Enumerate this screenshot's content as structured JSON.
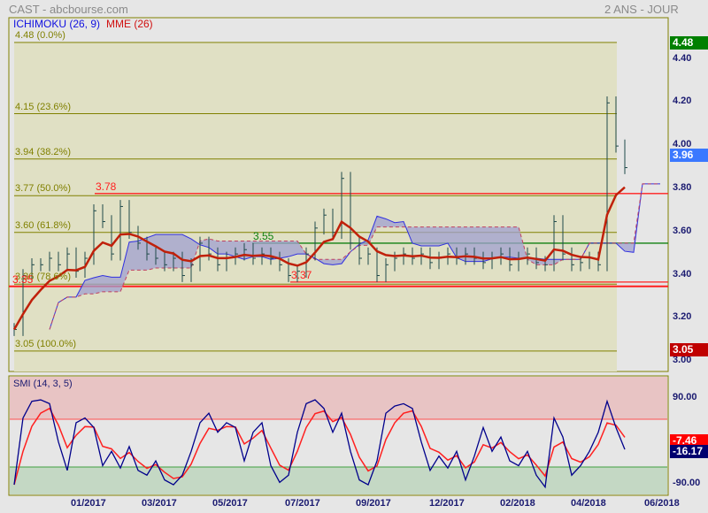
{
  "header": {
    "title": "CAST - abcbourse.com",
    "period": "2 ANS - JOUR"
  },
  "legend": {
    "ichimoku": "ICHIMOKU (26, 9)",
    "mme": "MME (26)",
    "smi": "SMI (14, 3, 5)"
  },
  "colors": {
    "price": "#1f4a4a",
    "mme": "#c0200a",
    "cloud_line": "#3030e0",
    "cloud_fill": "#a0a0d0",
    "kijun_dash": "#c04060",
    "fib": "#808000",
    "red": "#ff2020",
    "green": "#108010"
  },
  "chart_data": [
    {
      "type": "bar",
      "title": "CAST",
      "ylim": [
        3.0,
        4.48
      ],
      "y_ticks": [
        "4.40",
        "4.20",
        "4.00",
        "3.80",
        "3.60",
        "3.40",
        "3.20",
        "3.00"
      ],
      "x_ticks": [
        "01/2017",
        "03/2017",
        "05/2017",
        "07/2017",
        "09/2017",
        "12/2017",
        "02/2018",
        "04/2018",
        "06/2018"
      ],
      "fib_levels": [
        {
          "price": 4.48,
          "label": "4.48  (0.0%)"
        },
        {
          "price": 4.15,
          "label": "4.15  (23.6%)"
        },
        {
          "price": 3.94,
          "label": "3.94  (38.2%)"
        },
        {
          "price": 3.77,
          "label": "3.77  (50.0%)"
        },
        {
          "price": 3.6,
          "label": "3.60  (61.8%)"
        },
        {
          "price": 3.36,
          "label": "3.36  (78.6%)"
        },
        {
          "price": 3.05,
          "label": "3.05  (100.0%)"
        }
      ],
      "levels": [
        {
          "price": 3.78,
          "label": "3.78",
          "color": "red"
        },
        {
          "price": 3.55,
          "label": "3.55",
          "color": "green"
        },
        {
          "price": 3.37,
          "label": "3.37",
          "color": "red"
        },
        {
          "price": 3.35,
          "label": "3.35",
          "color": "red"
        }
      ],
      "badges": {
        "high": "4.48",
        "last": "3.96",
        "low": "3.05"
      },
      "close": [
        3.15,
        3.4,
        3.45,
        3.45,
        3.48,
        3.45,
        3.5,
        3.42,
        3.48,
        3.7,
        3.65,
        3.5,
        3.72,
        3.6,
        3.55,
        3.5,
        3.48,
        3.45,
        3.48,
        3.4,
        3.45,
        3.55,
        3.5,
        3.45,
        3.48,
        3.5,
        3.52,
        3.48,
        3.5,
        3.48,
        3.45,
        3.4,
        3.42,
        3.5,
        3.62,
        3.68,
        3.6,
        3.85,
        3.55,
        3.48,
        3.5,
        3.4,
        3.45,
        3.48,
        3.5,
        3.48,
        3.5,
        3.46,
        3.48,
        3.5,
        3.48,
        3.5,
        3.48,
        3.46,
        3.48,
        3.5,
        3.45,
        3.48,
        3.5,
        3.46,
        3.45,
        3.65,
        3.5,
        3.45,
        3.46,
        3.48,
        3.45,
        4.2,
        4.0,
        3.9
      ]
    },
    {
      "type": "line",
      "title": "SMI (14, 3, 5)",
      "ylim": [
        -90,
        90
      ],
      "y_ticks": [
        "90.00",
        "-90.00"
      ],
      "levels": [
        40,
        -40
      ],
      "badges": {
        "signal": "-7.46",
        "smi": "-16.17"
      },
      "smi": [
        -90,
        50,
        85,
        88,
        80,
        0,
        -60,
        40,
        50,
        30,
        -50,
        -20,
        -55,
        -10,
        -60,
        -70,
        -40,
        -80,
        -90,
        -70,
        -20,
        40,
        60,
        20,
        40,
        30,
        -40,
        20,
        40,
        -50,
        -85,
        -70,
        20,
        80,
        88,
        70,
        20,
        60,
        -20,
        -80,
        -90,
        -40,
        60,
        75,
        80,
        70,
        0,
        -60,
        -30,
        -55,
        -20,
        -80,
        -30,
        30,
        -20,
        10,
        -40,
        -50,
        -20,
        -70,
        -95,
        50,
        10,
        -70,
        -50,
        -20,
        20,
        85,
        30,
        -16
      ]
    }
  ]
}
